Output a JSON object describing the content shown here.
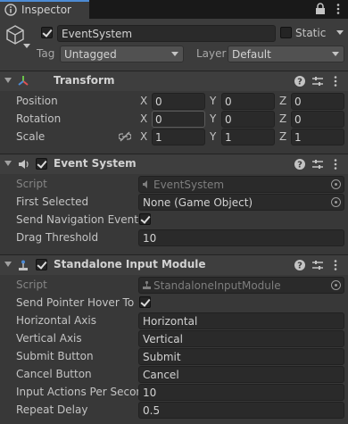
{
  "window": {
    "tab_label": "Inspector"
  },
  "header": {
    "object_name": "EventSystem",
    "static_label": "Static",
    "tag_label": "Tag",
    "tag_value": "Untagged",
    "layer_label": "Layer",
    "layer_value": "Default"
  },
  "transform": {
    "title": "Transform",
    "rows": [
      {
        "label": "Position",
        "x": "0",
        "y": "0",
        "z": "0"
      },
      {
        "label": "Rotation",
        "x": "0",
        "y": "0",
        "z": "0"
      },
      {
        "label": "Scale",
        "x": "1",
        "y": "1",
        "z": "1"
      }
    ],
    "axis_x": "X",
    "axis_y": "Y",
    "axis_z": "Z"
  },
  "event_system": {
    "title": "Event System",
    "script_label": "Script",
    "script_value": "EventSystem",
    "first_selected_label": "First Selected",
    "first_selected_value": "None (Game Object)",
    "send_nav_label": "Send Navigation Events",
    "send_nav_checked": true,
    "drag_label": "Drag Threshold",
    "drag_value": "10"
  },
  "input_module": {
    "title": "Standalone Input Module",
    "script_label": "Script",
    "script_value": "StandaloneInputModule",
    "hover_label": "Send Pointer Hover To P",
    "hover_checked": true,
    "horizontal_label": "Horizontal Axis",
    "horizontal_value": "Horizontal",
    "vertical_label": "Vertical Axis",
    "vertical_value": "Vertical",
    "submit_label": "Submit Button",
    "submit_value": "Submit",
    "cancel_label": "Cancel Button",
    "cancel_value": "Cancel",
    "ips_label": "Input Actions Per Secon",
    "ips_value": "10",
    "repeat_label": "Repeat Delay",
    "repeat_value": "0.5"
  },
  "colors": {
    "accent": "#4d8bd4",
    "panel": "#383838",
    "header": "#3e3e3e",
    "field": "#2a2a2a"
  }
}
